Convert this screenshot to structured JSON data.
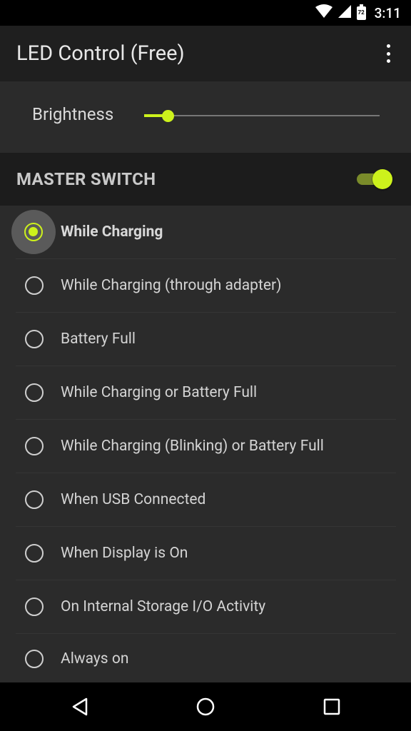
{
  "status_bar": {
    "time": "3:11",
    "battery_level": "72",
    "icons": [
      "wifi-icon",
      "cell-signal-icon",
      "battery-icon"
    ]
  },
  "app_bar": {
    "title": "LED Control (Free)",
    "overflow_icon": "more-vert-icon"
  },
  "brightness": {
    "label": "Brightness",
    "value_fraction": 0.1
  },
  "master_switch": {
    "label": "MASTER SWITCH",
    "enabled": true
  },
  "options": [
    {
      "label": "While Charging",
      "selected": true
    },
    {
      "label": "While Charging (through adapter)",
      "selected": false
    },
    {
      "label": "Battery Full",
      "selected": false
    },
    {
      "label": "While Charging or Battery Full",
      "selected": false
    },
    {
      "label": "While Charging (Blinking) or Battery Full",
      "selected": false
    },
    {
      "label": "When USB Connected",
      "selected": false
    },
    {
      "label": "When Display is On",
      "selected": false
    },
    {
      "label": "On Internal Storage I/O Activity",
      "selected": false
    },
    {
      "label": "Always on",
      "selected": false
    }
  ],
  "nav_bar": {
    "icons": [
      "back-icon",
      "home-icon",
      "recents-icon"
    ]
  },
  "colors": {
    "accent": "#cdf21c",
    "background": "#2b2b2b",
    "app_bar": "#1f1f1f"
  }
}
